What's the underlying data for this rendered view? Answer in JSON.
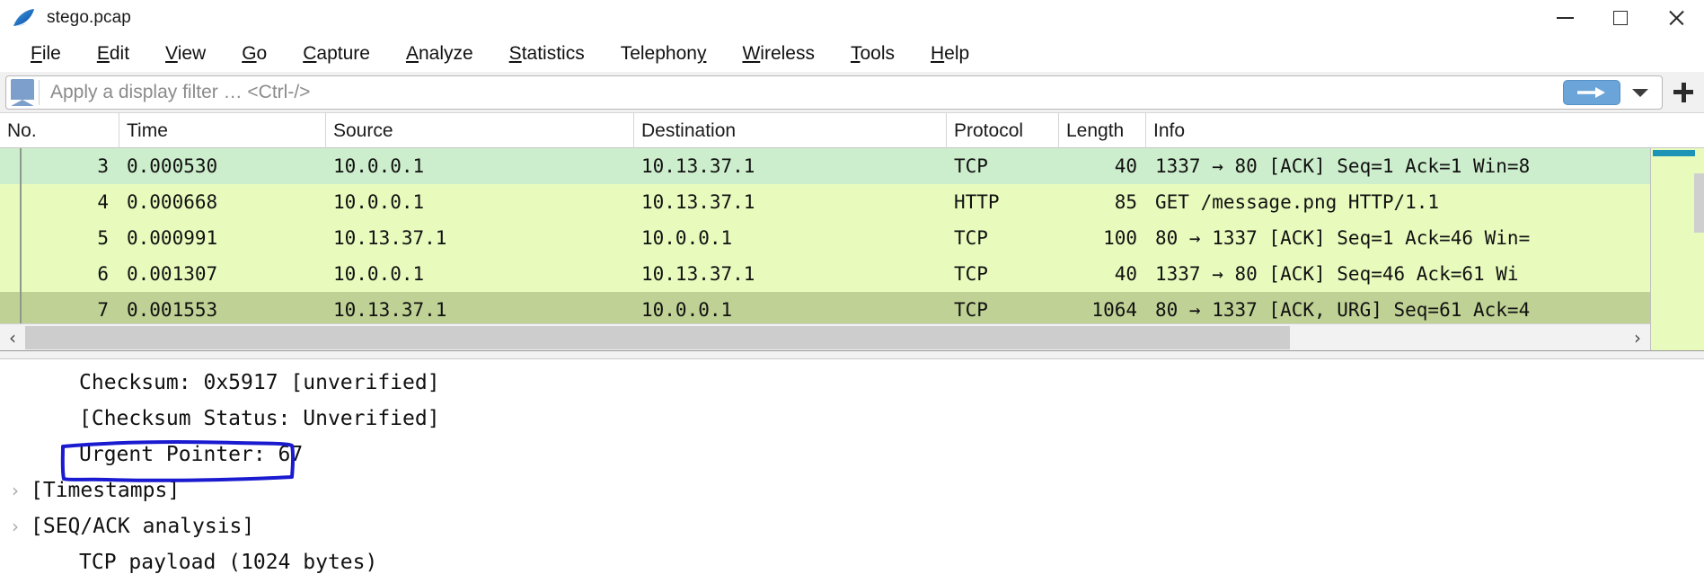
{
  "window": {
    "title": "stego.pcap",
    "app_icon": "wireshark-shark-fin-icon",
    "minimize_label": "—",
    "maximize_label": "□",
    "close_label": "×"
  },
  "menubar": {
    "items": [
      {
        "label": "File",
        "mnemonic": "F",
        "rest": "ile"
      },
      {
        "label": "Edit",
        "mnemonic": "E",
        "rest": "dit"
      },
      {
        "label": "View",
        "mnemonic": "V",
        "rest": "iew"
      },
      {
        "label": "Go",
        "mnemonic": "G",
        "rest": "o"
      },
      {
        "label": "Capture",
        "mnemonic": "C",
        "rest": "apture"
      },
      {
        "label": "Analyze",
        "mnemonic": "A",
        "rest": "nalyze"
      },
      {
        "label": "Statistics",
        "mnemonic": "S",
        "rest": "tatistics"
      },
      {
        "label": "Telephony",
        "mnemonic": "y",
        "rest": "Telephon"
      },
      {
        "label": "Wireless",
        "mnemonic": "W",
        "rest": "ireless"
      },
      {
        "label": "Tools",
        "mnemonic": "T",
        "rest": "ools"
      },
      {
        "label": "Help",
        "mnemonic": "H",
        "rest": "elp"
      }
    ]
  },
  "filter_bar": {
    "bookmark_icon": "bookmark-icon",
    "value": "",
    "placeholder": "Apply a display filter … <Ctrl-/>",
    "apply_icon": "arrow-right-icon",
    "dropdown_icon": "chevron-down-icon",
    "add_icon": "plus-icon",
    "accent_color": "#6aa4d8"
  },
  "packet_list": {
    "columns": [
      {
        "key": "no",
        "label": "No."
      },
      {
        "key": "time",
        "label": "Time"
      },
      {
        "key": "src",
        "label": "Source"
      },
      {
        "key": "dst",
        "label": "Destination"
      },
      {
        "key": "proto",
        "label": "Protocol"
      },
      {
        "key": "len",
        "label": "Length"
      },
      {
        "key": "info",
        "label": "Info"
      }
    ],
    "rows": [
      {
        "no": "3",
        "time": "0.000530",
        "src": "10.0.0.1",
        "dst": "10.13.37.1",
        "proto": "TCP",
        "len": "40",
        "info": "1337 → 80 [ACK] Seq=1 Ack=1 Win=8",
        "bg": "#cdeecd",
        "selected": false
      },
      {
        "no": "4",
        "time": "0.000668",
        "src": "10.0.0.1",
        "dst": "10.13.37.1",
        "proto": "HTTP",
        "len": "85",
        "info": "GET /message.png HTTP/1.1",
        "bg": "#e8fbbd",
        "selected": false
      },
      {
        "no": "5",
        "time": "0.000991",
        "src": "10.13.37.1",
        "dst": "10.0.0.1",
        "proto": "TCP",
        "len": "100",
        "info": "80 → 1337 [ACK] Seq=1 Ack=46 Win=",
        "bg": "#e8fbbd",
        "selected": false
      },
      {
        "no": "6",
        "time": "0.001307",
        "src": "10.0.0.1",
        "dst": "10.13.37.1",
        "proto": "TCP",
        "len": "40",
        "info": "1337 → 80 [ACK] Seq=46 Ack=61 Wi",
        "bg": "#e8fbbd",
        "selected": false
      },
      {
        "no": "7",
        "time": "0.001553",
        "src": "10.13.37.1",
        "dst": "10.0.0.1",
        "proto": "TCP",
        "len": "1064",
        "info": "80 → 1337 [ACK, URG] Seq=61 Ack=4",
        "bg": "#bfd194",
        "selected": true
      }
    ],
    "hscroll": {
      "left_arrow": "‹",
      "right_arrow": "›"
    },
    "packet_map_top_marker_color": "#1d93b5"
  },
  "detail_pane": {
    "rows": [
      {
        "expander": "",
        "text": "Checksum: 0x5917 [unverified]",
        "indent": 1,
        "highlighted": false
      },
      {
        "expander": "",
        "text": "[Checksum Status: Unverified]",
        "indent": 1,
        "highlighted": false
      },
      {
        "expander": "",
        "text": "Urgent Pointer: 67",
        "indent": 1,
        "highlighted": true
      },
      {
        "expander": "›",
        "text": "[Timestamps]",
        "indent": 0,
        "highlighted": false
      },
      {
        "expander": "›",
        "text": "[SEQ/ACK analysis]",
        "indent": 0,
        "highlighted": false
      },
      {
        "expander": "",
        "text": "TCP payload (1024 bytes)",
        "indent": 1,
        "highlighted": false
      }
    ]
  },
  "annotation": {
    "shape": "hand-drawn-rectangle",
    "color": "#1a1ad0",
    "targets": "Urgent Pointer: 67"
  }
}
